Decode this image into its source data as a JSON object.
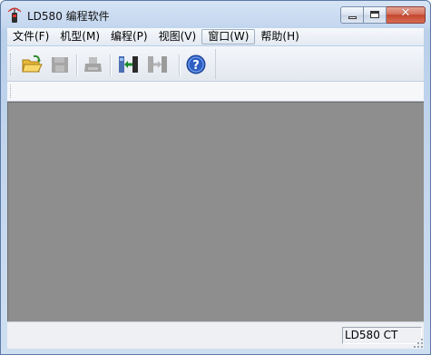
{
  "window": {
    "title": "LD580 编程软件"
  },
  "caption_buttons": {
    "minimize": "minimize",
    "maximize": "maximize",
    "close": "✕"
  },
  "menu": {
    "items": [
      {
        "label": "文件(F)",
        "icon": ""
      },
      {
        "label": "机型(M)"
      },
      {
        "label": "编程(P)"
      },
      {
        "label": "视图(V)"
      },
      {
        "label": "窗口(W)"
      },
      {
        "label": "帮助(H)"
      }
    ]
  },
  "toolbar": {
    "buttons": [
      {
        "name": "open-folder-icon",
        "enabled": true
      },
      {
        "name": "save-icon",
        "enabled": false
      },
      {
        "name": "print-icon",
        "enabled": false
      },
      {
        "name": "download-icon",
        "enabled": true
      },
      {
        "name": "upload-icon",
        "enabled": false
      },
      {
        "name": "help-icon",
        "enabled": true
      }
    ]
  },
  "status": {
    "model": "LD580 CT"
  },
  "colors": {
    "client_bg": "#8e8e8e",
    "title_gradient_top": "#d6e4f5",
    "close_red": "#c3462f"
  }
}
